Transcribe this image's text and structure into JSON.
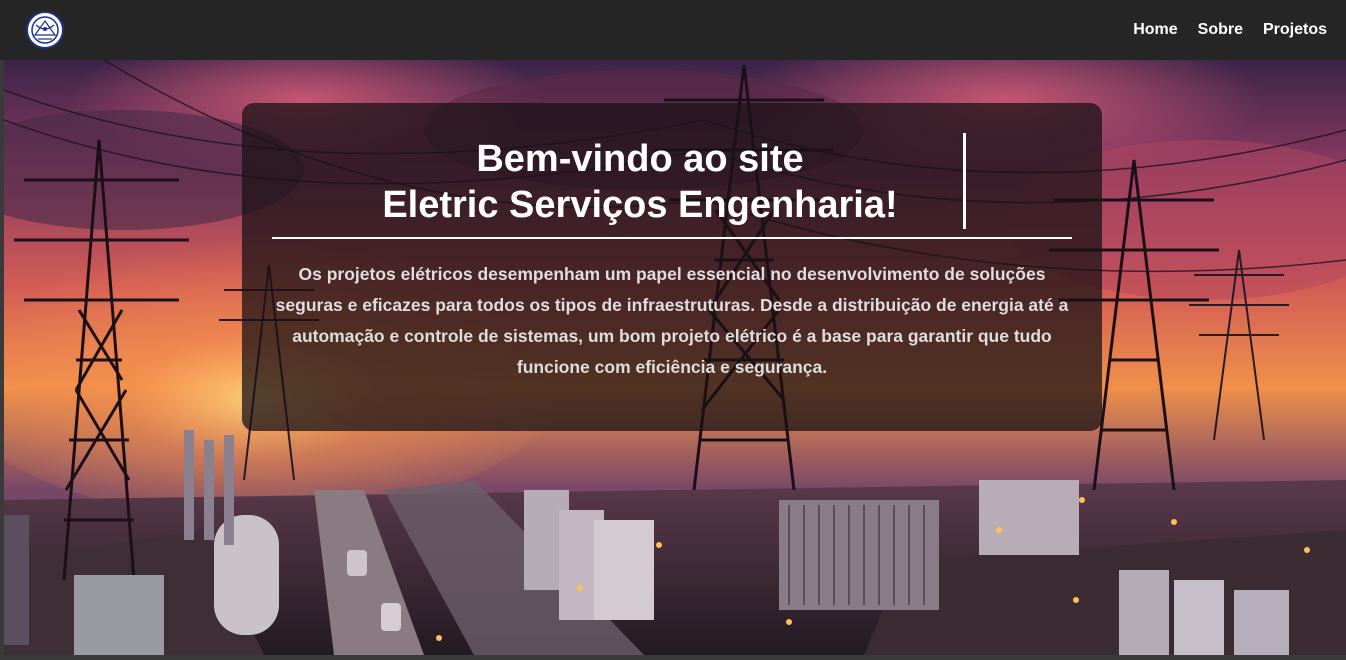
{
  "navbar": {
    "logo_icon": "company-logo-icon",
    "links": [
      {
        "label": "Home"
      },
      {
        "label": "Sobre"
      },
      {
        "label": "Projetos"
      }
    ]
  },
  "hero": {
    "background": "power-transmission-towers-sunset-image",
    "title_line1": "Bem-vindo ao site",
    "title_line2": "Eletric Serviços Engenharia!",
    "intro": "Os projetos elétricos desempenham um papel essencial no desenvolvimento de soluções seguras e eficazes para todos os tipos de infraestruturas. Desde a distribuição de energia até a automação e controle de sistemas, um bom projeto elétrico é a base para garantir que tudo funcione com eficiência e segurança."
  },
  "colors": {
    "navbar_bg": "#262626",
    "nav_text": "#ffffff",
    "card_bg": "rgba(25,18,22,0.74)",
    "logo_ring": "#1e2f8c"
  }
}
